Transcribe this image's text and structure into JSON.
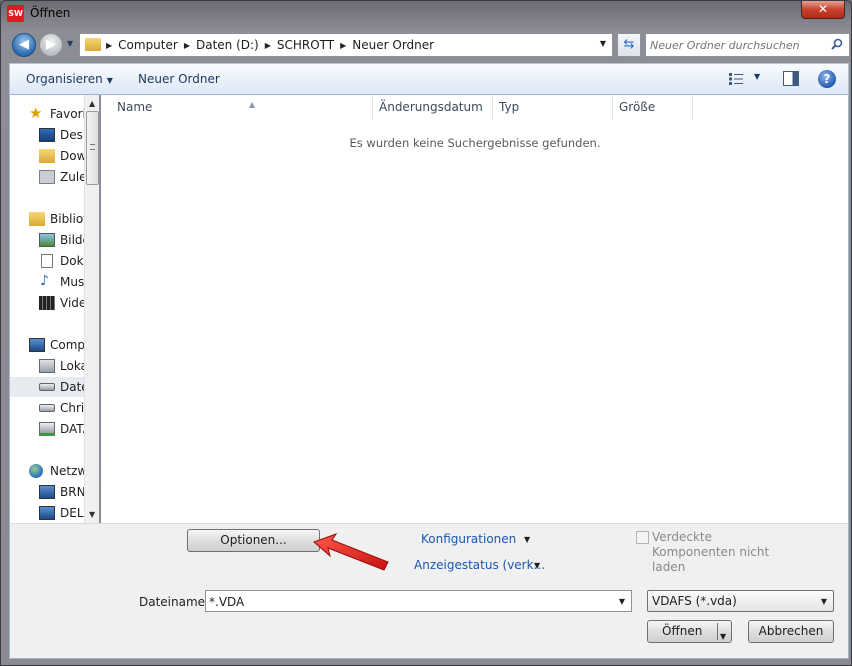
{
  "window": {
    "title": "Öffnen",
    "app_icon_text": "SW"
  },
  "navigation": {
    "breadcrumbs": [
      "Computer",
      "Daten (D:)",
      "SCHROTT",
      "Neuer Ordner"
    ],
    "search_placeholder": "Neuer Ordner durchsuchen"
  },
  "toolbar": {
    "organize_label": "Organisieren",
    "new_folder_label": "Neuer Ordner"
  },
  "nav_pane": {
    "items": [
      {
        "label": "Favoriten",
        "icon": "star-icon"
      },
      {
        "label": "Desktop",
        "icon": "desktop-icon"
      },
      {
        "label": "Downloads",
        "icon": "downloads-icon"
      },
      {
        "label": "Zuletzt besucht",
        "icon": "recent-places-icon"
      },
      {
        "label": "Bibliotheken",
        "icon": "libraries-icon"
      },
      {
        "label": "Bilder",
        "icon": "pictures-icon"
      },
      {
        "label": "Dokumente",
        "icon": "documents-icon"
      },
      {
        "label": "Musik",
        "icon": "music-icon"
      },
      {
        "label": "Videos",
        "icon": "videos-icon"
      },
      {
        "label": "Computer",
        "icon": "computer-icon"
      },
      {
        "label": "Lokaler Datenträger",
        "icon": "local-disk-icon"
      },
      {
        "label": "Daten (D:)",
        "icon": "drive-icon",
        "selected": true
      },
      {
        "label": "Christ",
        "icon": "drive-icon"
      },
      {
        "label": "DATA",
        "icon": "network-drive-icon"
      },
      {
        "label": "Netzwerk",
        "icon": "network-icon"
      },
      {
        "label": "BRN",
        "icon": "network-computer-icon"
      },
      {
        "label": "DELL",
        "icon": "network-computer-icon"
      }
    ]
  },
  "file_list": {
    "columns": [
      "Name",
      "Änderungsdatum",
      "Typ",
      "Größe"
    ],
    "empty_message": "Es wurden keine Suchergebnisse gefunden."
  },
  "bottom": {
    "options_button": "Optionen...",
    "configurations_label": "Konfigurationen",
    "display_state_label": "Anzeigestatus (verk...",
    "hidden_components_label": "Verdeckte Komponenten nicht laden",
    "filename_label": "Dateiname:",
    "filename_value": "*.VDA",
    "filetype_value": "VDAFS (*.vda)",
    "open_button": "Öffnen",
    "cancel_button": "Abbrechen"
  },
  "colors": {
    "link": "#1a57b0",
    "annotation_arrow": "#e01e1e"
  }
}
